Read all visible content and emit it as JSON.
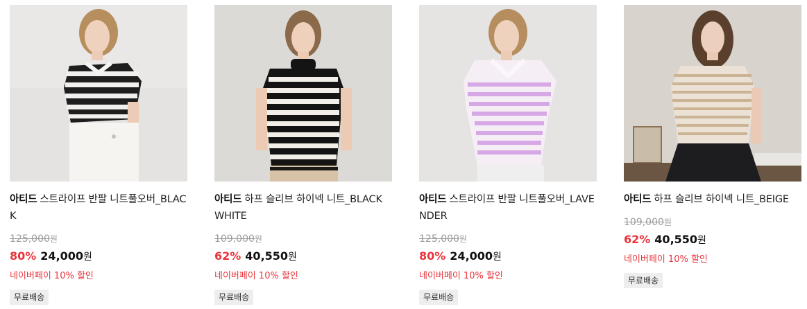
{
  "products": [
    {
      "brand": "아티드",
      "name": "스트라이프 반팔 니트풀오버_BLACK",
      "original_price": "125,000",
      "original_won": "원",
      "discount_rate": "80%",
      "sale_price": "24,000",
      "sale_won": "원",
      "npay": "네이버페이 10% 할인",
      "badge": "무료배송"
    },
    {
      "brand": "아티드",
      "name": "하프 슬리브 하이넥 니트_BLACK WHITE",
      "original_price": "109,000",
      "original_won": "원",
      "discount_rate": "62%",
      "sale_price": "40,550",
      "sale_won": "원",
      "npay": "네이버페이 10% 할인",
      "badge": "무료배송"
    },
    {
      "brand": "아티드",
      "name": "스트라이프 반팔 니트풀오버_LAVENDER",
      "original_price": "125,000",
      "original_won": "원",
      "discount_rate": "80%",
      "sale_price": "24,000",
      "sale_won": "원",
      "npay": "네이버페이 10% 할인",
      "badge": "무료배송"
    },
    {
      "brand": "아티드",
      "name": "하프 슬리브 하이넥 니트_BEIGE",
      "original_price": "109,000",
      "original_won": "원",
      "discount_rate": "62%",
      "sale_price": "40,550",
      "sale_won": "원",
      "npay": "네이버페이 10% 할인",
      "badge": "무료배송"
    }
  ],
  "colors": {
    "discount": "#e8343b",
    "badge_bg": "#eeeeee"
  }
}
